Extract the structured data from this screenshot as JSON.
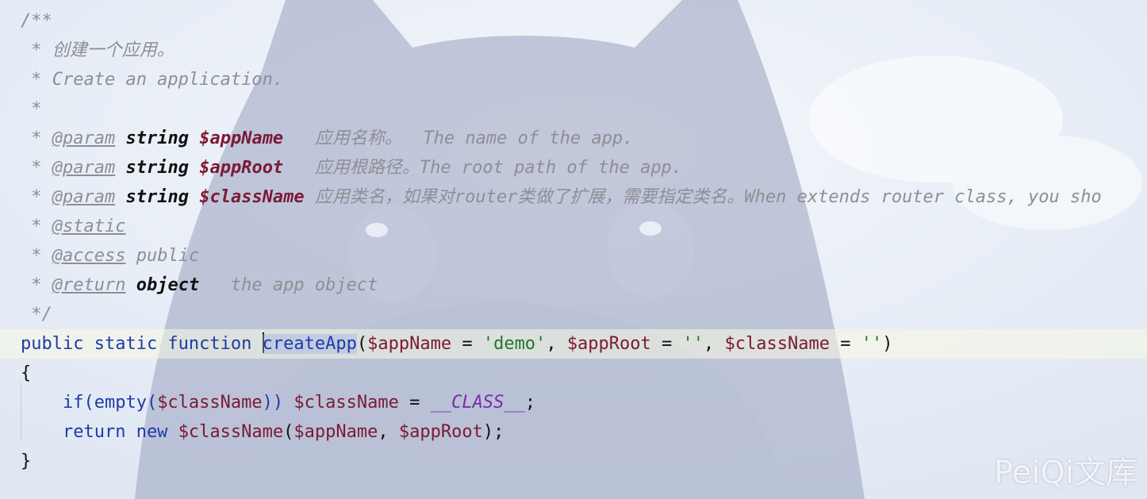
{
  "code_lines": [
    {
      "segments": [
        {
          "t": "/**",
          "c": "c"
        }
      ]
    },
    {
      "segments": [
        {
          "t": " * 创建一个应用。",
          "c": "c"
        }
      ]
    },
    {
      "segments": [
        {
          "t": " * Create an application.",
          "c": "c"
        }
      ]
    },
    {
      "segments": [
        {
          "t": " *",
          "c": "c"
        }
      ]
    },
    {
      "segments": [
        {
          "t": " * ",
          "c": "c"
        },
        {
          "t": "@param",
          "c": "tag"
        },
        {
          "t": " ",
          "c": "c"
        },
        {
          "t": "string",
          "c": "type"
        },
        {
          "t": " ",
          "c": "c"
        },
        {
          "t": "$appName",
          "c": "pvar"
        },
        {
          "t": "   应用名称。  The name of the app.",
          "c": "c"
        }
      ]
    },
    {
      "segments": [
        {
          "t": " * ",
          "c": "c"
        },
        {
          "t": "@param",
          "c": "tag"
        },
        {
          "t": " ",
          "c": "c"
        },
        {
          "t": "string",
          "c": "type"
        },
        {
          "t": " ",
          "c": "c"
        },
        {
          "t": "$appRoot",
          "c": "pvar"
        },
        {
          "t": "   应用根路径。The root path of the app.",
          "c": "c"
        }
      ]
    },
    {
      "segments": [
        {
          "t": " * ",
          "c": "c"
        },
        {
          "t": "@param",
          "c": "tag"
        },
        {
          "t": " ",
          "c": "c"
        },
        {
          "t": "string",
          "c": "type"
        },
        {
          "t": " ",
          "c": "c"
        },
        {
          "t": "$className",
          "c": "pvar"
        },
        {
          "t": " 应用类名，如果对router类做了扩展，需要指定类名。When extends router class, you sho",
          "c": "c"
        }
      ]
    },
    {
      "segments": [
        {
          "t": " * ",
          "c": "c"
        },
        {
          "t": "@static",
          "c": "tag"
        }
      ]
    },
    {
      "segments": [
        {
          "t": " * ",
          "c": "c"
        },
        {
          "t": "@access",
          "c": "tag"
        },
        {
          "t": " public",
          "c": "c"
        }
      ]
    },
    {
      "segments": [
        {
          "t": " * ",
          "c": "c"
        },
        {
          "t": "@return",
          "c": "tag"
        },
        {
          "t": " ",
          "c": "c"
        },
        {
          "t": "object",
          "c": "type"
        },
        {
          "t": "   the app object",
          "c": "c"
        }
      ]
    },
    {
      "segments": [
        {
          "t": " */",
          "c": "c"
        }
      ]
    },
    {
      "current": true,
      "segments": [
        {
          "t": "public static function ",
          "c": "kw"
        },
        {
          "cursor": true
        },
        {
          "t": "createApp",
          "c": "fn"
        },
        {
          "t": "(",
          "c": "punc"
        },
        {
          "t": "$appName",
          "c": "var"
        },
        {
          "t": " = ",
          "c": "punc"
        },
        {
          "t": "'demo'",
          "c": "str"
        },
        {
          "t": ", ",
          "c": "punc"
        },
        {
          "t": "$appRoot",
          "c": "var"
        },
        {
          "t": " = ",
          "c": "punc"
        },
        {
          "t": "''",
          "c": "str"
        },
        {
          "t": ", ",
          "c": "punc"
        },
        {
          "t": "$className",
          "c": "var"
        },
        {
          "t": " = ",
          "c": "punc"
        },
        {
          "t": "''",
          "c": "str"
        },
        {
          "t": ")",
          "c": "punc"
        }
      ]
    },
    {
      "segments": [
        {
          "t": "{",
          "c": "punc"
        }
      ]
    },
    {
      "segments": [
        {
          "t": "    if(empty(",
          "c": "kw"
        },
        {
          "t": "$className",
          "c": "var"
        },
        {
          "t": ")) ",
          "c": "kw"
        },
        {
          "t": "$className",
          "c": "var"
        },
        {
          "t": " = ",
          "c": "punc"
        },
        {
          "t": "__CLASS__",
          "c": "const"
        },
        {
          "t": ";",
          "c": "punc"
        }
      ]
    },
    {
      "segments": [
        {
          "t": "    return new ",
          "c": "kw"
        },
        {
          "t": "$className",
          "c": "var"
        },
        {
          "t": "(",
          "c": "punc"
        },
        {
          "t": "$appName",
          "c": "var"
        },
        {
          "t": ", ",
          "c": "punc"
        },
        {
          "t": "$appRoot",
          "c": "var"
        },
        {
          "t": ");",
          "c": "punc"
        }
      ]
    },
    {
      "segments": [
        {
          "t": "}",
          "c": "punc"
        }
      ]
    }
  ],
  "watermark": "PeiQi文库"
}
